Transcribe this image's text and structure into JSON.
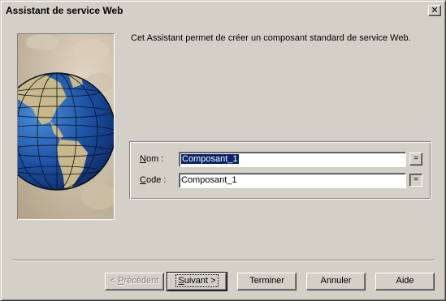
{
  "window": {
    "title": "Assistant de service Web",
    "close_label": "✕",
    "colors": {
      "face": "#d4d0c8",
      "selection": "#0a246a",
      "ocean": "#1a4fa0",
      "land": "#c9b98a"
    }
  },
  "intro": {
    "text": "Cet Assistant permet de créer un composant standard de service Web."
  },
  "fields": {
    "name": {
      "label_accel": "N",
      "label_rest": "om :",
      "value": "Composant_1",
      "eq_label": "="
    },
    "code": {
      "label_accel": "C",
      "label_rest": "ode :",
      "value": "Composant_1",
      "eq_label": "="
    }
  },
  "buttons": {
    "previous": {
      "prefix": "< ",
      "accel": "P",
      "rest": "récédent"
    },
    "next": {
      "accel": "S",
      "rest": "uivant >"
    },
    "finish": {
      "label": "Terminer"
    },
    "cancel": {
      "label": "Annuler"
    },
    "help": {
      "label": "Aide"
    }
  }
}
